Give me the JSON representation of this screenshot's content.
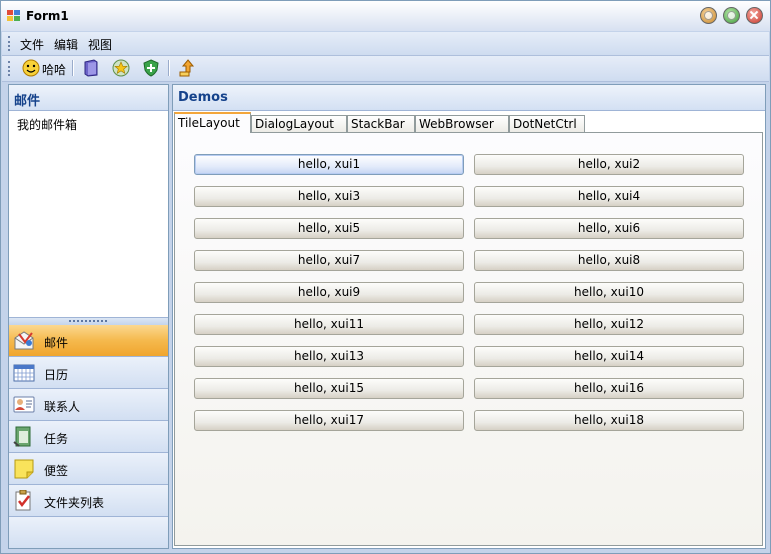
{
  "window": {
    "title": "Form1"
  },
  "menu": {
    "items": [
      "文件",
      "编辑",
      "视图"
    ]
  },
  "toolbar": {
    "button_label": "哈哈"
  },
  "left_panel": {
    "header": "邮件",
    "tree_item": "我的邮件箱",
    "nav_items": [
      {
        "label": "邮件",
        "icon": "mail-icon",
        "active": true
      },
      {
        "label": "日历",
        "icon": "calendar-icon",
        "active": false
      },
      {
        "label": "联系人",
        "icon": "contacts-icon",
        "active": false
      },
      {
        "label": "任务",
        "icon": "tasks-icon",
        "active": false
      },
      {
        "label": "便签",
        "icon": "notes-icon",
        "active": false
      },
      {
        "label": "文件夹列表",
        "icon": "folder-list-icon",
        "active": false
      }
    ]
  },
  "right_panel": {
    "header": "Demos",
    "tabs": [
      "TileLayout",
      "DialogLayout",
      "StackBar",
      "WebBrowser",
      "DotNetCtrl"
    ],
    "active_tab": "TileLayout",
    "tiles": [
      "hello, xui1",
      "hello, xui2",
      "hello, xui3",
      "hello, xui4",
      "hello, xui5",
      "hello, xui6",
      "hello, xui7",
      "hello, xui8",
      "hello, xui9",
      "hello, xui10",
      "hello, xui11",
      "hello, xui12",
      "hello, xui13",
      "hello, xui14",
      "hello, xui15",
      "hello, xui16",
      "hello, xui17",
      "hello, xui18"
    ]
  },
  "colors": {
    "accent": "#15428b",
    "active_nav": "#f5b94d",
    "tab_highlight": "#f3a63b"
  }
}
